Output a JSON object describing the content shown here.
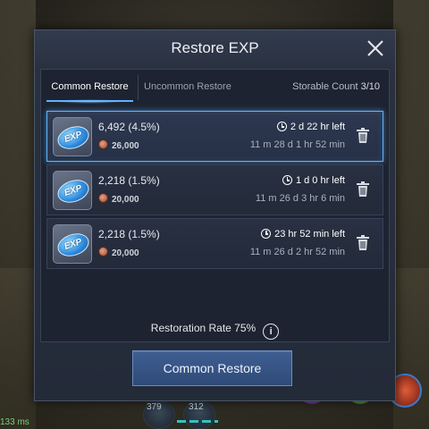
{
  "dialog": {
    "title": "Restore EXP",
    "tabs": [
      {
        "label": "Common Restore",
        "active": true
      },
      {
        "label": "Uncommon Restore",
        "active": false
      }
    ],
    "storable_label": "Storable Count",
    "storable_count": "3/10",
    "items": [
      {
        "amount": "6,492 (4.5%)",
        "cost": "26,000",
        "time_left": "2 d 22 hr left",
        "date": "11 m 28 d 1 hr 52 min",
        "selected": true
      },
      {
        "amount": "2,218 (1.5%)",
        "cost": "20,000",
        "time_left": "1 d 0 hr left",
        "date": "11 m 26 d 3 hr 6 min",
        "selected": false
      },
      {
        "amount": "2,218 (1.5%)",
        "cost": "20,000",
        "time_left": "23 hr 52 min left",
        "date": "11 m 26 d 2 hr 52 min",
        "selected": false
      }
    ],
    "exp_icon_text": "EXP",
    "restoration_rate": "Restoration Rate 75%",
    "info_glyph": "i",
    "restore_button": "Common Restore"
  },
  "hud": {
    "ping": "133 ms",
    "slot_counts": [
      "379",
      "312"
    ]
  },
  "colors": {
    "accent_blue": "#5fb3ff",
    "button_blue": "#3f5f92",
    "panel_bg": "#1d2330"
  }
}
